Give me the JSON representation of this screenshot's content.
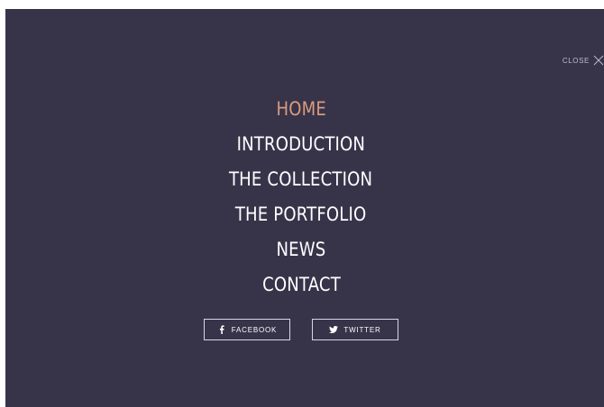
{
  "close": {
    "label": "CLOSE"
  },
  "nav": {
    "items": [
      {
        "label": "HOME",
        "active": true
      },
      {
        "label": "INTRODUCTION",
        "active": false
      },
      {
        "label": "THE COLLECTION",
        "active": false
      },
      {
        "label": "THE PORTFOLIO",
        "active": false
      },
      {
        "label": "NEWS",
        "active": false
      },
      {
        "label": "CONTACT",
        "active": false
      }
    ]
  },
  "social": {
    "facebook": {
      "label": "FACEBOOK",
      "icon": "facebook-icon"
    },
    "twitter": {
      "label": "TWITTER",
      "icon": "twitter-icon"
    }
  },
  "colors": {
    "background": "#37344a",
    "active": "#d89b7d",
    "text": "#ffffff"
  }
}
